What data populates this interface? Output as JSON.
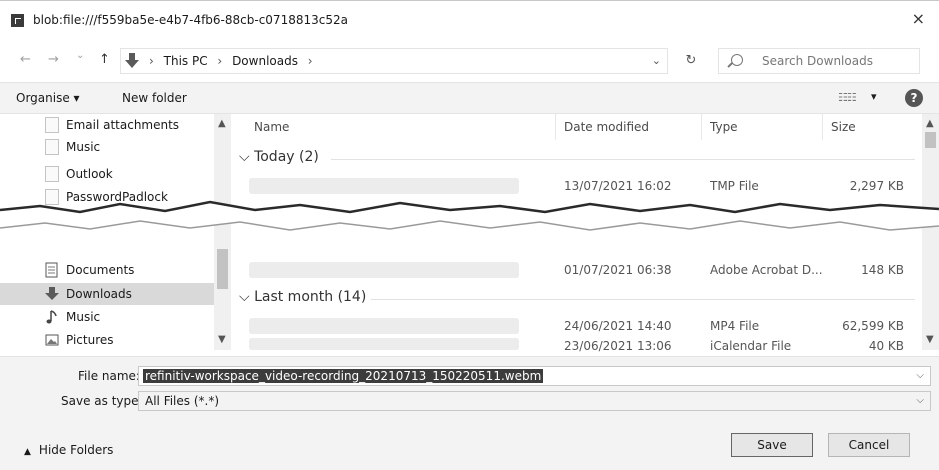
{
  "window": {
    "title": "blob:file:///f559ba5e-e4b7-4fb6-88cb-c0718813c52a",
    "close_label": "×"
  },
  "nav": {
    "back": "←",
    "forward": "→",
    "recent": "⌄",
    "up": "↑",
    "breadcrumbs": [
      "This PC",
      "Downloads"
    ],
    "crumb_sep": "›",
    "address_drop": "⌄",
    "refresh": "↻",
    "search_placeholder": "Search Downloads"
  },
  "toolbar": {
    "organise_label": "Organise ▾",
    "new_folder_label": "New folder",
    "views_icon": "☷☷",
    "views_drop": "▾",
    "help_label": "?"
  },
  "sidebar": {
    "items": [
      {
        "label": "Email attachments",
        "icon": "folder-icon"
      },
      {
        "label": "Music",
        "icon": "folder-icon"
      },
      {
        "label": "Outlook",
        "icon": "folder-icon"
      },
      {
        "label": "PasswordPadlock",
        "icon": "folder-icon"
      },
      {
        "label": "Documents",
        "icon": "document-icon"
      },
      {
        "label": "Downloads",
        "icon": "download-icon",
        "selected": true
      },
      {
        "label": "Music",
        "icon": "music-icon"
      },
      {
        "label": "Pictures",
        "icon": "pictures-icon"
      }
    ]
  },
  "files": {
    "columns": {
      "name": "Name",
      "date": "Date modified",
      "type": "Type",
      "size": "Size"
    },
    "groups": [
      {
        "label": "Today (2)",
        "rows": [
          {
            "date": "13/07/2021 16:02",
            "type": "TMP File",
            "size": "2,297 KB"
          }
        ]
      },
      {
        "rows": [
          {
            "date": "01/07/2021 06:38",
            "type": "Adobe Acrobat D...",
            "size": "148 KB"
          }
        ]
      },
      {
        "label": "Last month (14)",
        "rows": [
          {
            "date": "24/06/2021 14:40",
            "type": "MP4 File",
            "size": "62,599 KB"
          },
          {
            "date": "23/06/2021 13:06",
            "type": "iCalendar File",
            "size": "40 KB"
          }
        ]
      }
    ]
  },
  "form": {
    "file_name_label": "File name:",
    "file_name_value": "refinitiv-workspace_video-recording_20210713_150220511.webm",
    "save_type_label": "Save as type:",
    "save_type_value": "All Files (*.*)",
    "hide_folders_label": "Hide Folders",
    "save_button": "Save",
    "cancel_button": "Cancel"
  },
  "colors": {
    "selection": "#3c3c3c",
    "toolbar_bg": "#f3f3f3",
    "selected_item": "#d9d9d9"
  }
}
